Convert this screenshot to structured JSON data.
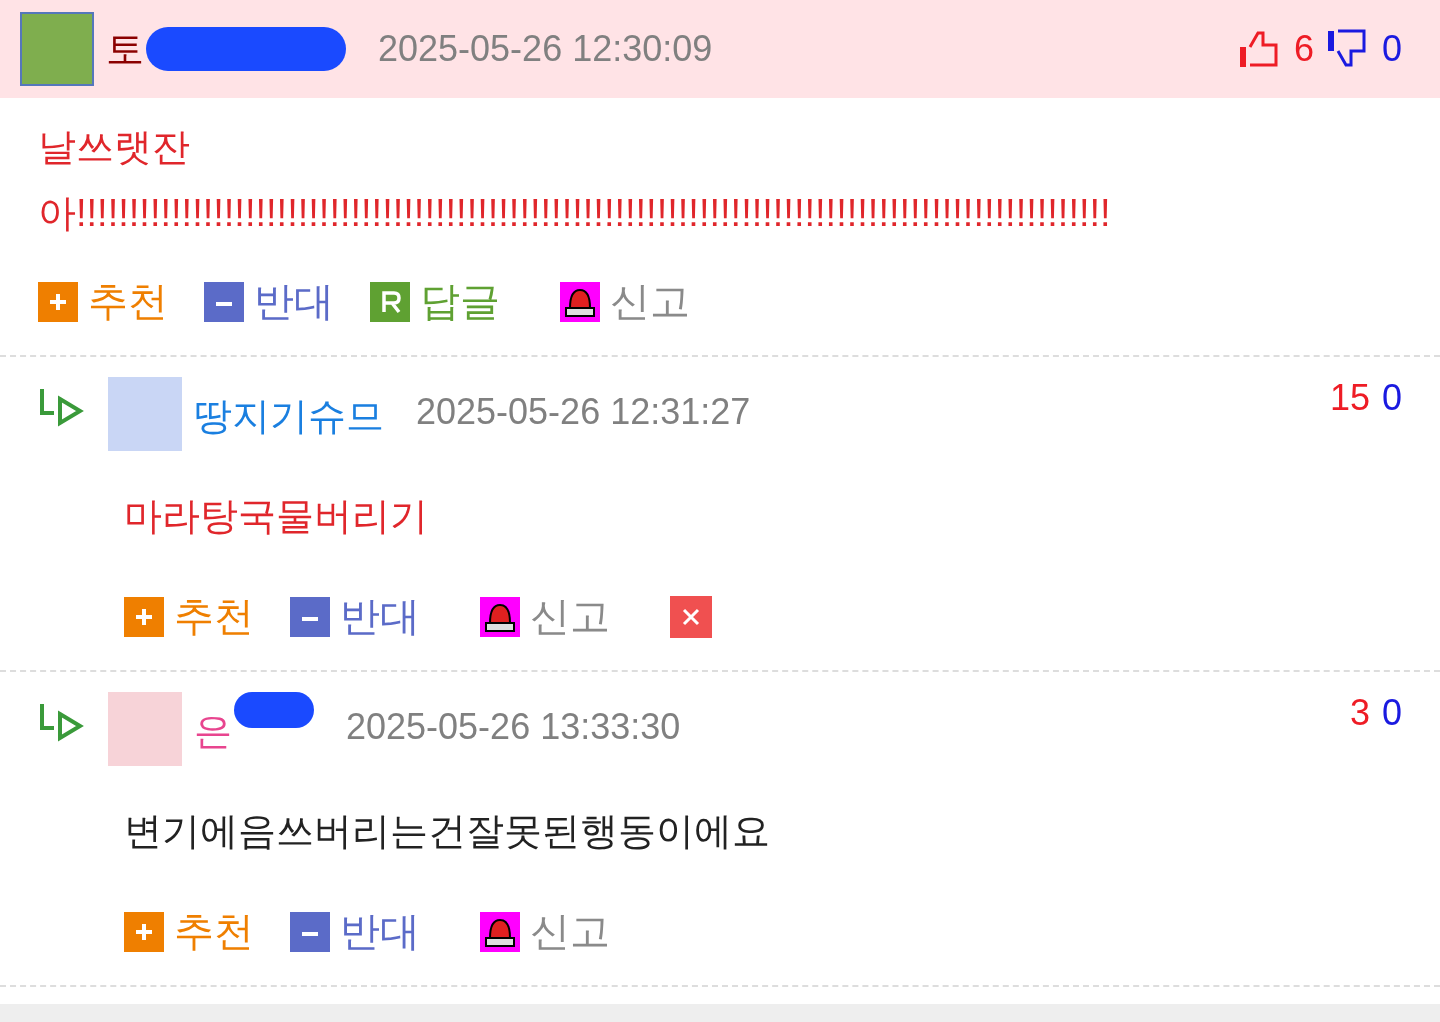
{
  "comments": [
    {
      "kind": "top",
      "avatar": {
        "color": "#7fae4e"
      },
      "name": {
        "text": "토",
        "color": "#8b0000",
        "redacted": true
      },
      "date": "2025-05-26 12:30:09",
      "votes": {
        "up": "6",
        "down": "0"
      },
      "body": {
        "color": "#e0262b",
        "lines": [
          "날쓰랫잔",
          "아!!!!!!!!!!!!!!!!!!!!!!!!!!!!!!!!!!!!!!!!!!!!!!!!!!!!!!!!!!!!!!!!!!!!!!!!!!!!!!!!!!!!!!!!!!!!!!!!!!"
        ]
      },
      "actions": [
        {
          "kind": "recommend",
          "label": "추천"
        },
        {
          "kind": "oppose",
          "label": "반대"
        },
        {
          "kind": "reply",
          "label": "답글"
        },
        {
          "kind": "report",
          "label": "신고"
        }
      ]
    },
    {
      "kind": "reply",
      "avatar": {
        "color": "#c9d6f5"
      },
      "name": {
        "text": "땅지기슈므",
        "color": "#1a7fe0",
        "redacted": false
      },
      "date": "2025-05-26 12:31:27",
      "score": {
        "up": "15",
        "down": "0"
      },
      "body": {
        "color": "#e0262b",
        "lines": [
          "마라탕국물버리기"
        ]
      },
      "actions": [
        {
          "kind": "recommend",
          "label": "추천"
        },
        {
          "kind": "oppose",
          "label": "반대"
        },
        {
          "kind": "report",
          "label": "신고"
        },
        {
          "kind": "delete"
        }
      ]
    },
    {
      "kind": "reply",
      "avatar": {
        "color": "#f7d3d8"
      },
      "name": {
        "text": "은",
        "color": "#e8458f",
        "redacted": true
      },
      "date": "2025-05-26 13:33:30",
      "score": {
        "up": "3",
        "down": "0"
      },
      "body": {
        "color": "#222222",
        "lines": [
          "변기에음쓰버리는건잘못된행동이에요"
        ]
      },
      "actions": [
        {
          "kind": "recommend",
          "label": "추천"
        },
        {
          "kind": "oppose",
          "label": "반대"
        },
        {
          "kind": "report",
          "label": "신고"
        }
      ]
    }
  ]
}
